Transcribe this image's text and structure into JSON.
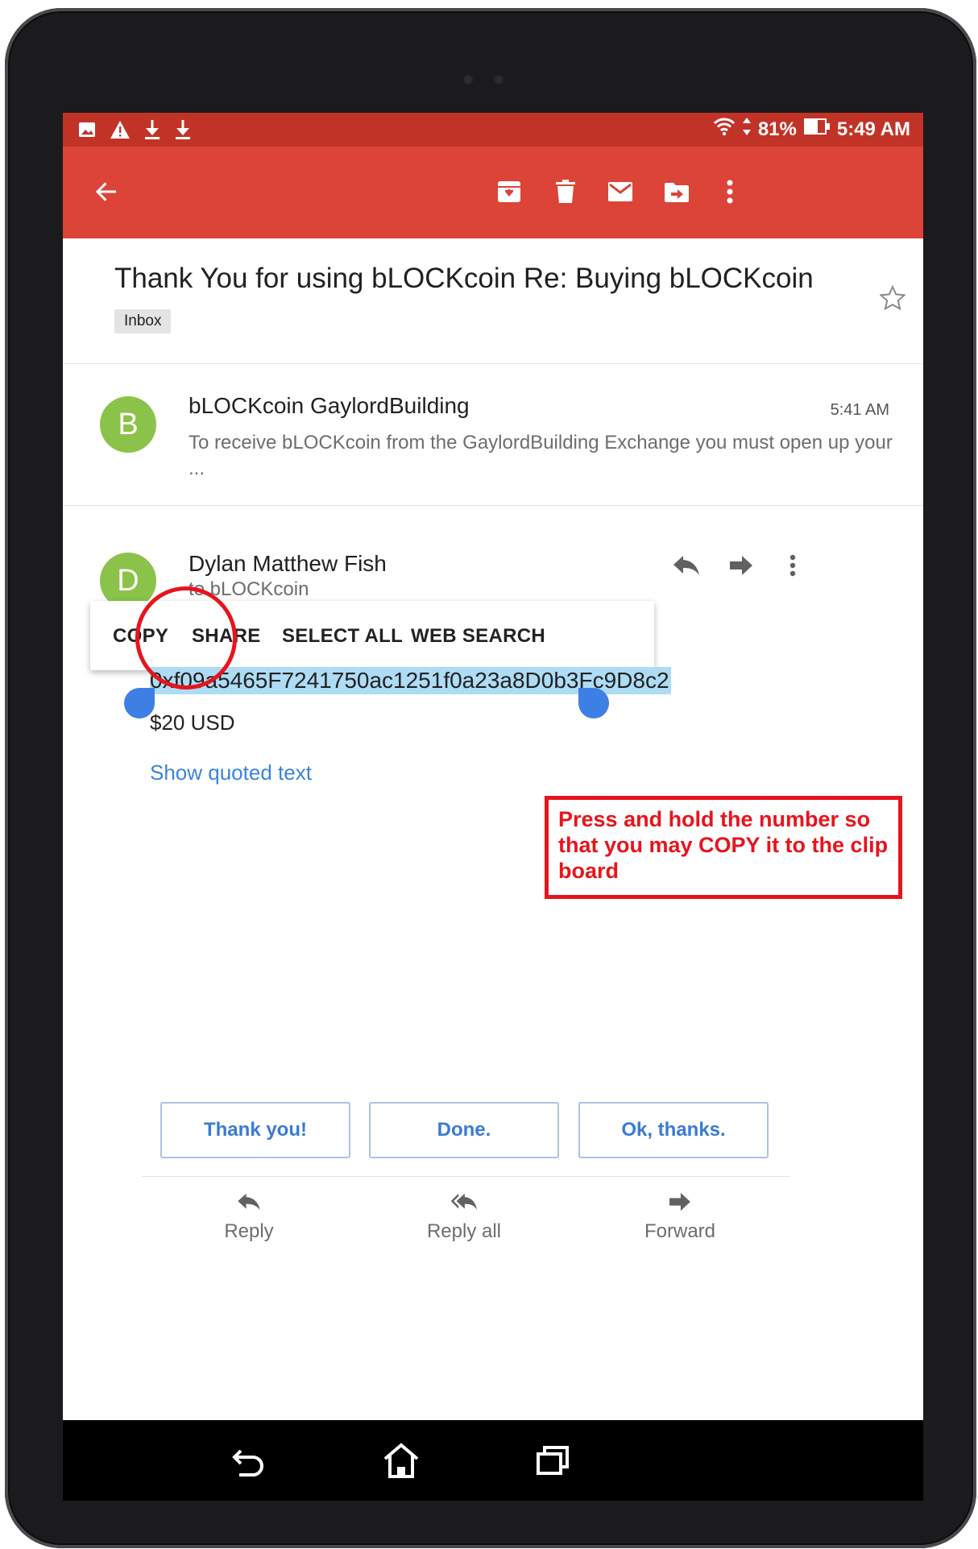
{
  "statusbar": {
    "battery": "81%",
    "time": "5:49 AM",
    "icons_left": [
      "image-icon",
      "warning-icon",
      "download-icon",
      "download-icon"
    ],
    "icons_right": [
      "wifi-icon",
      "data-arrows-icon",
      "battery-icon"
    ]
  },
  "toolbar": {
    "icons": [
      "back-arrow-icon",
      "archive-icon",
      "delete-icon",
      "mark-unread-icon",
      "move-to-icon",
      "more-vert-icon"
    ]
  },
  "thread": {
    "subject": "Thank You for using bLOCKcoin Re: Buying bLOCKcoin",
    "label": "Inbox"
  },
  "messages": [
    {
      "avatar_letter": "B",
      "sender": "bLOCKcoin GaylordBuilding",
      "time": "5:41 AM",
      "snippet": "To receive bLOCKcoin from the GaylordBuilding Exchange you must open up your ..."
    },
    {
      "avatar_letter": "D",
      "sender": "Dylan Matthew Fish",
      "to": "to bLOCKcoin",
      "address": "0xf09a5465F7241750ac1251f0a23a8D0b3Fc9D8c2",
      "amount": "$20 USD",
      "show_quoted": "Show quoted text"
    }
  ],
  "context_menu": [
    "COPY",
    "SHARE",
    "SELECT ALL",
    "WEB SEARCH"
  ],
  "annotation": {
    "text": "Press and hold the number so that you may COPY it to the clip board",
    "color": "#e8141c"
  },
  "smart_replies": [
    "Thank you!",
    "Done.",
    "Ok, thanks."
  ],
  "bottom_actions": [
    {
      "label": "Reply"
    },
    {
      "label": "Reply all"
    },
    {
      "label": "Forward"
    }
  ],
  "colors": {
    "toolbar": "#db4437",
    "statusbar": "#c23327",
    "avatar": "#8bc34a",
    "link": "#3b84d9",
    "selection": "#aedcf5",
    "handle": "#3d7fe4"
  }
}
